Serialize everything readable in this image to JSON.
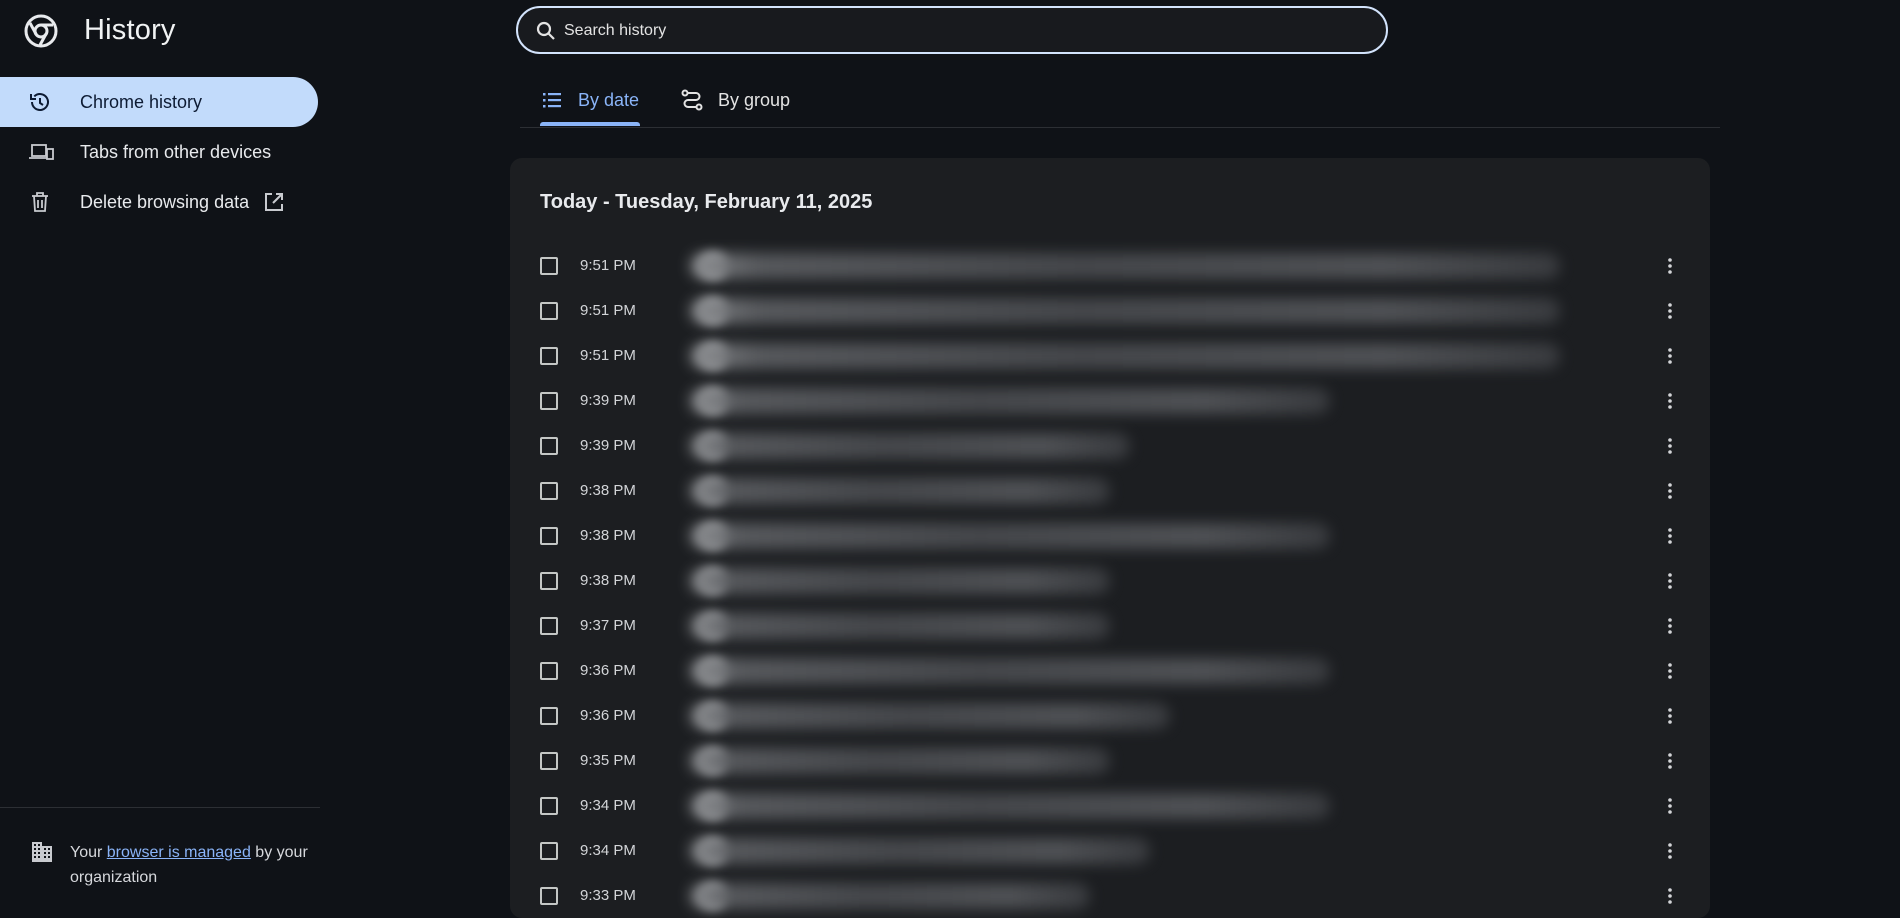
{
  "app": {
    "title": "History"
  },
  "sidebar": {
    "items": [
      {
        "label": "Chrome history",
        "icon": "history-icon",
        "active": true
      },
      {
        "label": "Tabs from other devices",
        "icon": "devices-icon",
        "active": false
      },
      {
        "label": "Delete browsing data",
        "icon": "trash-icon",
        "active": false,
        "trailing_icon": "open-in-new-icon"
      }
    ],
    "managed": {
      "prefix": "Your ",
      "link": "browser is managed",
      "suffix": " by your organization",
      "icon": "building-icon"
    }
  },
  "search": {
    "placeholder": "Search history",
    "value": ""
  },
  "tabs": [
    {
      "label": "By date",
      "icon": "list-icon",
      "selected": true
    },
    {
      "label": "By group",
      "icon": "route-icon",
      "selected": false
    }
  ],
  "history": {
    "date_heading": "Today - Tuesday, February 11, 2025",
    "entries": [
      {
        "time": "9:51 PM"
      },
      {
        "time": "9:51 PM"
      },
      {
        "time": "9:51 PM"
      },
      {
        "time": "9:39 PM"
      },
      {
        "time": "9:39 PM"
      },
      {
        "time": "9:38 PM"
      },
      {
        "time": "9:38 PM"
      },
      {
        "time": "9:38 PM"
      },
      {
        "time": "9:37 PM"
      },
      {
        "time": "9:36 PM"
      },
      {
        "time": "9:36 PM"
      },
      {
        "time": "9:35 PM"
      },
      {
        "time": "9:34 PM"
      },
      {
        "time": "9:34 PM"
      },
      {
        "time": "9:33 PM"
      }
    ]
  },
  "colors": {
    "background": "#0f1217",
    "card": "#1c1e21",
    "accent": "#8ab4f8",
    "active_nav": "#c2dbfb"
  }
}
